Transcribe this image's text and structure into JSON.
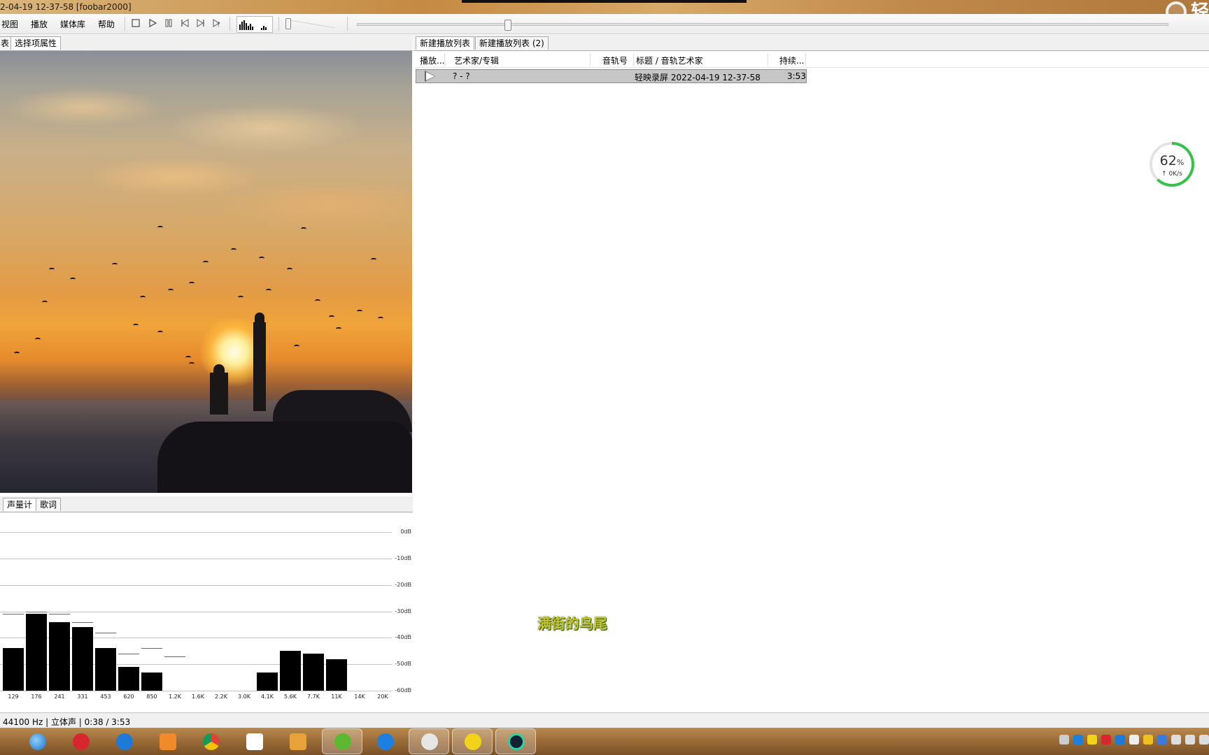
{
  "window": {
    "title": "2-04-19 12-37-58  [foobar2000]",
    "brand_text": "轻"
  },
  "menu": [
    "视图",
    "播放",
    "媒体库",
    "帮助"
  ],
  "toolbar": {
    "stop_icon": "stop-icon",
    "play_icon": "play-icon",
    "pause_icon": "pause-icon",
    "prev_icon": "previous-icon",
    "next_icon": "next-icon",
    "random_icon": "random-icon"
  },
  "left_tabs": [
    "表",
    "选择项属性"
  ],
  "vis_tabs": [
    "声量计",
    "歌词"
  ],
  "playlist_tabs": [
    "新建播放列表",
    "新建播放列表 (2)"
  ],
  "columns": {
    "playing": "播放...",
    "artist_album": "艺术家/专辑",
    "track_no": "音轨号",
    "title_artist": "标题 / 音轨艺术家",
    "duration": "持续..."
  },
  "playlist_rows": [
    {
      "artist_album": "? - ?",
      "track_no": "",
      "title_artist": "轻映录屏 2022-04-19 12-37-58",
      "duration": "3:53"
    }
  ],
  "gauge": {
    "percent": "62",
    "unit": "%",
    "speed": "↑ 0K/s",
    "fill_fraction": 0.62
  },
  "lyric": "满街的鸟尾",
  "status": "44100 Hz | 立体声 | 0:38 / 3:53",
  "spectrum": {
    "db_labels": [
      "0dB",
      "-10dB",
      "-20dB",
      "-30dB",
      "-40dB",
      "-50dB",
      "-60dB"
    ],
    "freq_labels": [
      "129",
      "176",
      "241",
      "331",
      "453",
      "620",
      "850",
      "1.2K",
      "1.6K",
      "2.2K",
      "3.0K",
      "4.1K",
      "5.6K",
      "7.7K",
      "11K",
      "14K",
      "20K"
    ],
    "levels_db": [
      -44,
      -31,
      -34,
      -36,
      -44,
      -51,
      -53,
      -60,
      -60,
      -60,
      -60,
      -53,
      -45,
      -46,
      -48,
      -60,
      -60
    ],
    "peaks_db": [
      -31,
      -30,
      -31,
      -34,
      -38,
      -46,
      -44,
      -47,
      -60,
      -60,
      -60,
      -53,
      -45,
      -46,
      -48,
      -60,
      -60
    ]
  },
  "taskbar": {
    "icons": [
      "ie-icon",
      "netease-music-icon",
      "kugou-icon",
      "orange-app-icon",
      "chrome-icon",
      "youku-icon",
      "video-player-icon",
      "green-arrow-icon",
      "feather-icon",
      "alien-app-icon",
      "banana-music-icon",
      "recorder-icon"
    ]
  }
}
